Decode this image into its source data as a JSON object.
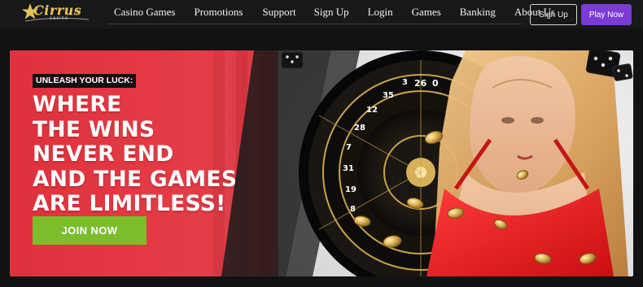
{
  "header": {
    "logo_text": "Cirrus",
    "logo_sub": "casino",
    "nav": [
      "Casino Games",
      "Promotions",
      "Support",
      "Sign Up",
      "Login",
      "Games",
      "Banking",
      "About Us"
    ],
    "signup_label": "Sign Up",
    "play_label": "Play Now"
  },
  "banner": {
    "tagline": "UNLEASH YOUR LUCK:",
    "headline": [
      "WHERE",
      "THE WINS",
      "NEVER END",
      "AND THE GAMES",
      "ARE LIMITLESS!"
    ],
    "cta": "JOIN NOW",
    "wheel_numbers": [
      "3",
      "26",
      "0",
      "35",
      "12",
      "28",
      "7",
      "31",
      "19",
      "8"
    ]
  },
  "colors": {
    "header_bg": "#17181a",
    "banner_red": "#e23a45",
    "join_green": "#7cbd2c",
    "play_purple": "#7a3bd6",
    "gold": "#e5c25a"
  },
  "icons": {
    "logo": "star-logo-icon",
    "dice": "dice-icon",
    "roulette": "roulette-wheel-icon",
    "coins": "gold-coin-icon"
  }
}
